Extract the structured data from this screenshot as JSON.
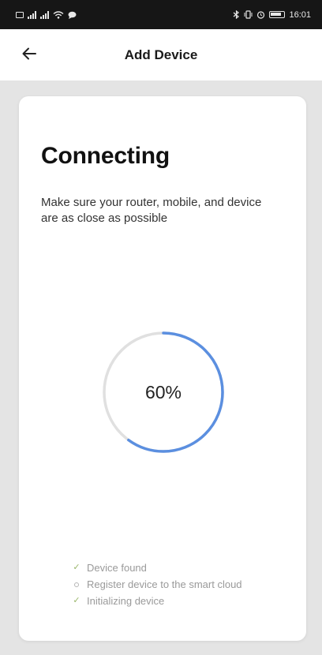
{
  "status_bar": {
    "time": "16:01",
    "battery": "88"
  },
  "header": {
    "title": "Add Device",
    "back_icon": "arrow-left-icon"
  },
  "main": {
    "heading": "Connecting",
    "description": "Make sure your router, mobile, and device are as close as possible",
    "progress": {
      "value": 60,
      "label": "60%"
    },
    "steps": [
      {
        "label": "Device found",
        "state": "done",
        "icon": "check-icon"
      },
      {
        "label": "Register device to the smart cloud",
        "state": "pending",
        "icon": "dot-icon"
      },
      {
        "label": "Initializing device",
        "state": "done",
        "icon": "check-icon"
      }
    ]
  },
  "colors": {
    "accent": "#5b8fe0",
    "track": "#e0e0e0",
    "check": "#9ab66a",
    "background": "#e4e4e4"
  }
}
